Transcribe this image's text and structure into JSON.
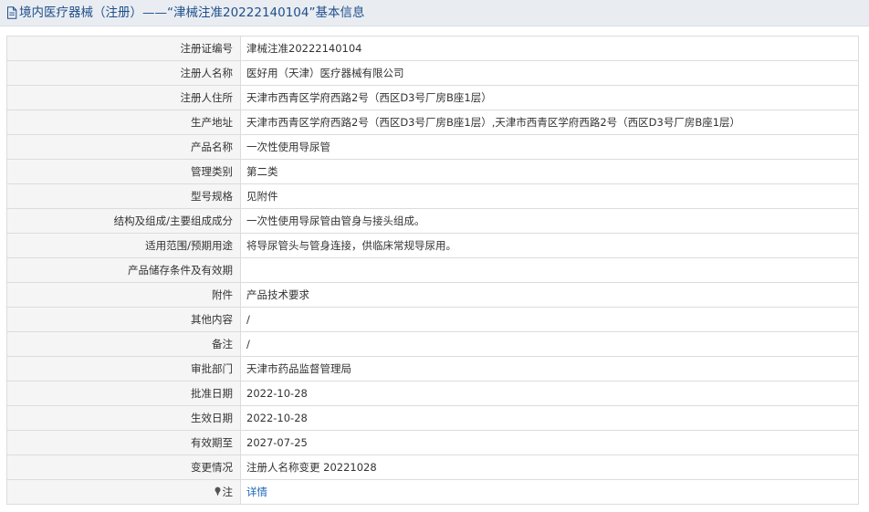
{
  "header": {
    "title": "境内医疗器械（注册）——“津械注准20222140104”基本信息",
    "icon": "document-icon"
  },
  "rows": [
    {
      "label": "注册证编号",
      "value": "津械注准20222140104"
    },
    {
      "label": "注册人名称",
      "value": "医好用（天津）医疗器械有限公司"
    },
    {
      "label": "注册人住所",
      "value": "天津市西青区学府西路2号（西区D3号厂房B座1层）"
    },
    {
      "label": "生产地址",
      "value": "天津市西青区学府西路2号（西区D3号厂房B座1层）,天津市西青区学府西路2号（西区D3号厂房B座1层）"
    },
    {
      "label": "产品名称",
      "value": "一次性使用导尿管"
    },
    {
      "label": "管理类别",
      "value": "第二类"
    },
    {
      "label": "型号规格",
      "value": "见附件"
    },
    {
      "label": "结构及组成/主要组成成分",
      "value": "一次性使用导尿管由管身与接头组成。"
    },
    {
      "label": "适用范围/预期用途",
      "value": "将导尿管头与管身连接，供临床常规导尿用。"
    },
    {
      "label": "产品储存条件及有效期",
      "value": ""
    },
    {
      "label": "附件",
      "value": "产品技术要求"
    },
    {
      "label": "其他内容",
      "value": "/"
    },
    {
      "label": "备注",
      "value": "/"
    },
    {
      "label": "审批部门",
      "value": "天津市药品监督管理局"
    },
    {
      "label": "批准日期",
      "value": "2022-10-28"
    },
    {
      "label": "生效日期",
      "value": "2022-10-28"
    },
    {
      "label": "有效期至",
      "value": "2027-07-25"
    },
    {
      "label": "变更情况",
      "value": "注册人名称变更 20221028"
    }
  ],
  "note_row": {
    "label": "注",
    "icon": "pin-icon",
    "link_text": "详情"
  },
  "colors": {
    "title_text": "#1f4e8c",
    "title_bg": "#e9edf1",
    "label_bg": "#f5f5f5",
    "border": "#dcdcdc",
    "link": "#1a64b8"
  }
}
